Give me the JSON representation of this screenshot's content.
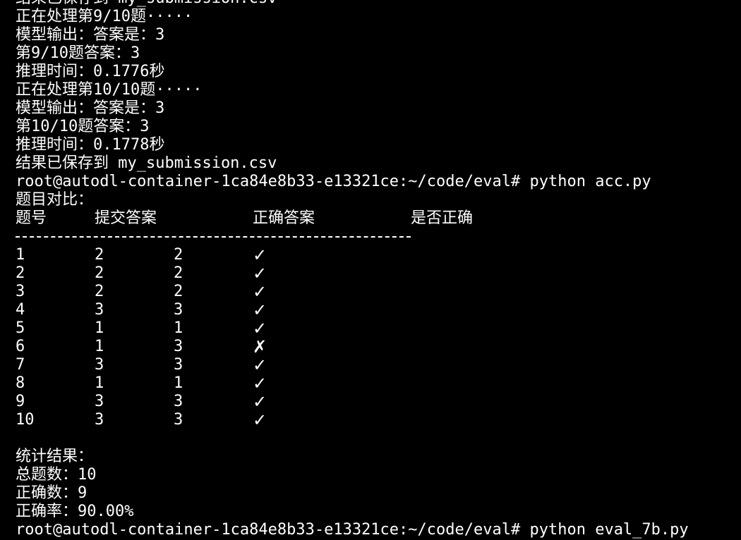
{
  "prev_lines": [
    "正在处理第9/10题·····",
    "模型输出：答案是：3",
    "第9/10题答案：3",
    "推理时间：0.1776秒",
    "正在处理第10/10题·····",
    "模型输出：答案是：3",
    "第10/10题答案：3",
    "推理时间：0.1778秒",
    "结果已保存到 my_submission.csv"
  ],
  "prompt_1": "root@autodl-container-1ca84e8b33-e13321ce:~/code/eval# python acc.py",
  "compare_title": "题目对比：",
  "table": {
    "headers": [
      "题号",
      "提交答案",
      "正确答案",
      "是否正确"
    ],
    "rows": [
      {
        "id": "1",
        "submitted": "2",
        "correct": "2",
        "result": "✓"
      },
      {
        "id": "2",
        "submitted": "2",
        "correct": "2",
        "result": "✓"
      },
      {
        "id": "3",
        "submitted": "2",
        "correct": "2",
        "result": "✓"
      },
      {
        "id": "4",
        "submitted": "3",
        "correct": "3",
        "result": "✓"
      },
      {
        "id": "5",
        "submitted": "1",
        "correct": "1",
        "result": "✓"
      },
      {
        "id": "6",
        "submitted": "1",
        "correct": "3",
        "result": "✗"
      },
      {
        "id": "7",
        "submitted": "3",
        "correct": "3",
        "result": "✓"
      },
      {
        "id": "8",
        "submitted": "1",
        "correct": "1",
        "result": "✓"
      },
      {
        "id": "9",
        "submitted": "3",
        "correct": "3",
        "result": "✓"
      },
      {
        "id": "10",
        "submitted": "3",
        "correct": "3",
        "result": "✓"
      }
    ]
  },
  "stats": {
    "title": "统计结果：",
    "total": "总题数：10",
    "correct": "正确数：9",
    "accuracy": "正确率：90.00%"
  },
  "prompt_2": "root@autodl-container-1ca84e8b33-e13321ce:~/code/eval# python eval_7b.py"
}
